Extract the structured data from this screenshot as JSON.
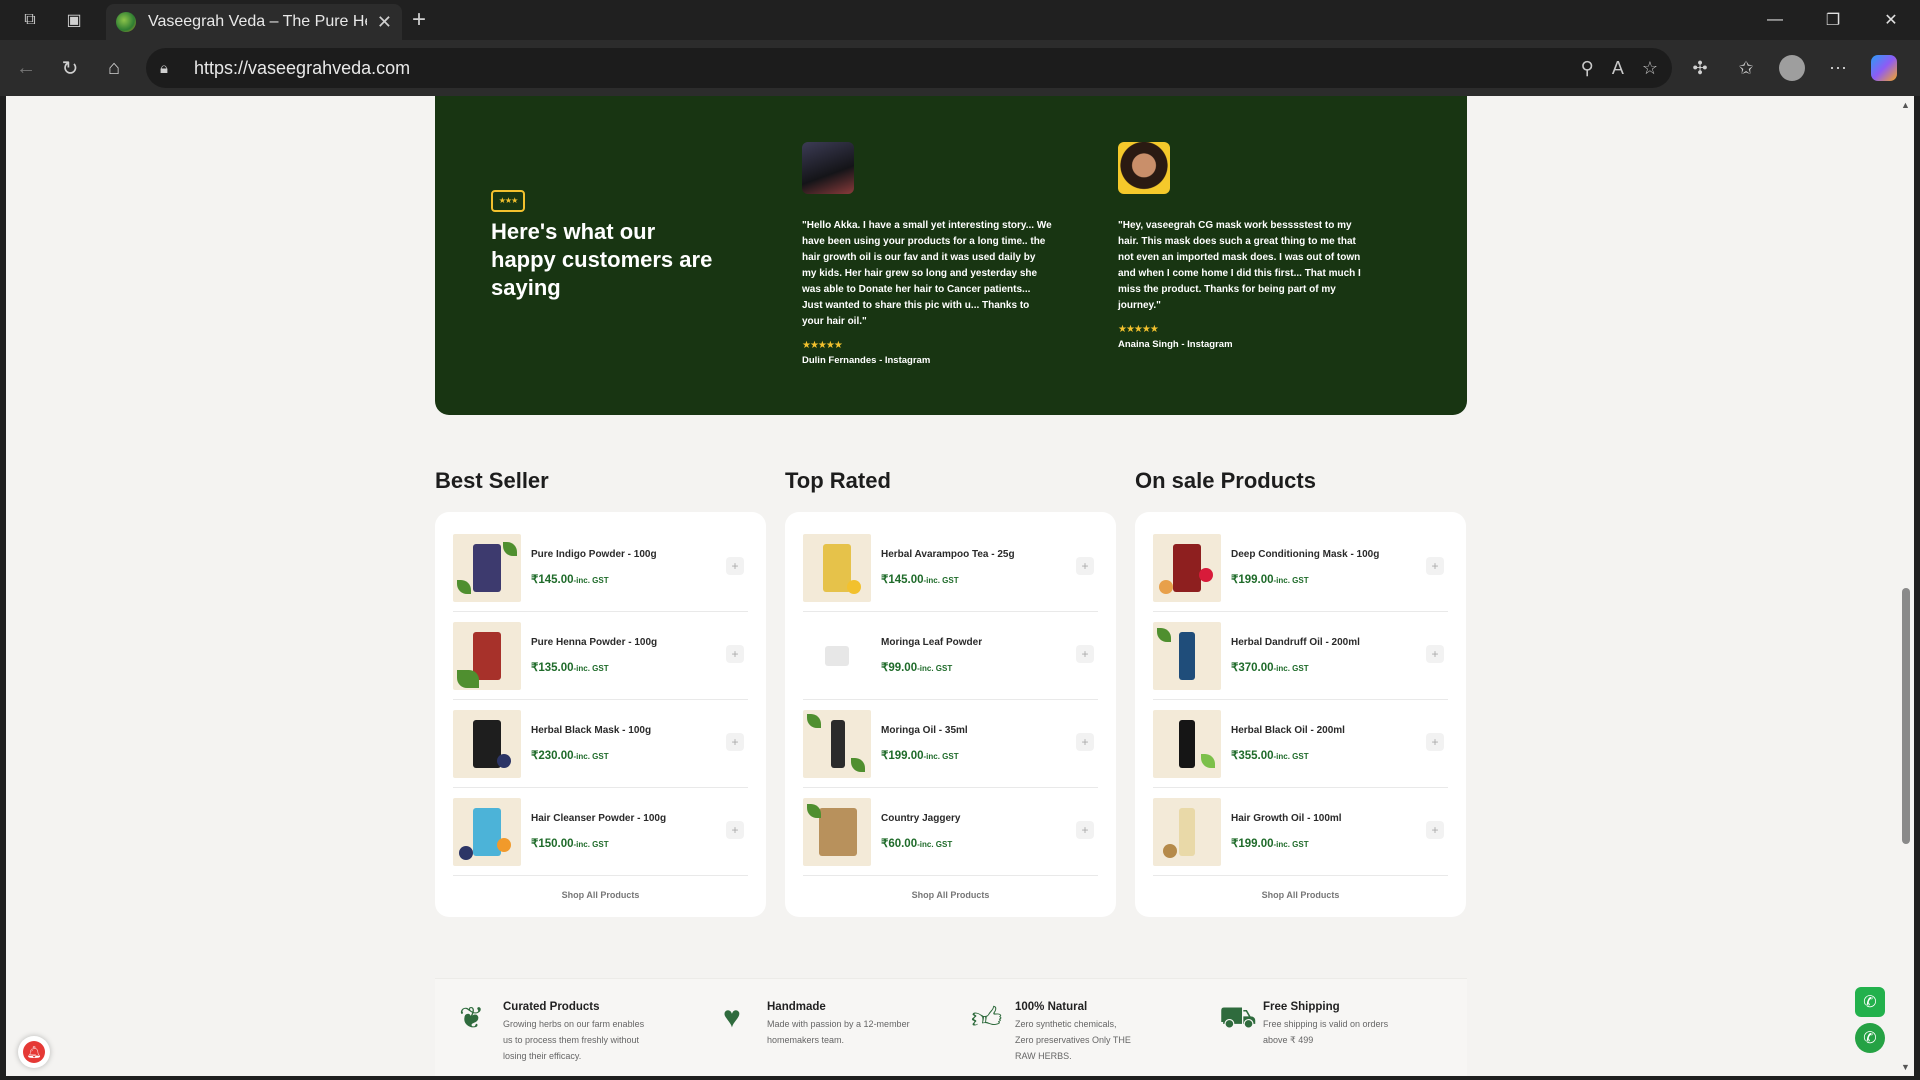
{
  "browser": {
    "tab_title": "Vaseegrah Veda – The Pure Herba",
    "url": "https://vaseegrahveda.com"
  },
  "testimonials": {
    "heading": "Here's what our happy customers are saying",
    "reviews": [
      {
        "text": "\"Hello Akka. I have a small yet interesting story... We have been using your products for a long time.. the hair growth oil is our fav and it was used daily by my kids. Her hair grew so long and yesterday she was able to Donate her hair to Cancer patients... Just wanted to share this pic with u... Thanks to your hair oil.\"",
        "stars": "★★★★★",
        "author": "Dulin Fernandes - Instagram"
      },
      {
        "text": "\"Hey, vaseegrah CG mask work besssstest to my hair. This mask does such a great thing to me that not even an imported mask does. I was out of town and when I come home I did this first... That much I miss the product. Thanks for being part of my journey.\"",
        "stars": "★★★★★",
        "author": "Anaina Singh - Instagram"
      }
    ]
  },
  "columns": [
    {
      "title": "Best Seller",
      "items": [
        {
          "name": "Pure Indigo Powder - 100g",
          "price": "₹145.00",
          "tax": "-inc. GST"
        },
        {
          "name": "Pure Henna Powder - 100g",
          "price": "₹135.00",
          "tax": "-inc. GST"
        },
        {
          "name": "Herbal Black Mask - 100g",
          "price": "₹230.00",
          "tax": "-inc. GST"
        },
        {
          "name": "Hair Cleanser Powder - 100g",
          "price": "₹150.00",
          "tax": "-inc. GST"
        }
      ],
      "shop_all": "Shop All Products"
    },
    {
      "title": "Top Rated",
      "items": [
        {
          "name": "Herbal Avarampoo Tea - 25g",
          "price": "₹145.00",
          "tax": "-inc. GST"
        },
        {
          "name": "Moringa Leaf Powder",
          "price": "₹99.00",
          "tax": "-inc. GST"
        },
        {
          "name": "Moringa Oil - 35ml",
          "price": "₹199.00",
          "tax": "-inc. GST"
        },
        {
          "name": "Country Jaggery",
          "price": "₹60.00",
          "tax": "-inc. GST"
        }
      ],
      "shop_all": "Shop All Products"
    },
    {
      "title": "On sale Products",
      "items": [
        {
          "name": "Deep Conditioning Mask - 100g",
          "price": "₹199.00",
          "tax": "-inc. GST"
        },
        {
          "name": "Herbal Dandruff Oil - 200ml",
          "price": "₹370.00",
          "tax": "-inc. GST"
        },
        {
          "name": "Herbal Black Oil - 200ml",
          "price": "₹355.00",
          "tax": "-inc. GST"
        },
        {
          "name": "Hair Growth Oil - 100ml",
          "price": "₹199.00",
          "tax": "-inc. GST"
        }
      ],
      "shop_all": "Shop All Products"
    }
  ],
  "features": [
    {
      "icon": "sprout-icon",
      "title": "Curated Products",
      "text": "Growing herbs on our farm enables us to process them freshly without losing their efficacy."
    },
    {
      "icon": "hand-heart-icon",
      "title": "Handmade",
      "text": "Made with passion by a 12-member homemakers team."
    },
    {
      "icon": "thumbs-up-icon",
      "title": "100% Natural",
      "text": "Zero synthetic chemicals, Zero preservatives Only THE RAW HERBS."
    },
    {
      "icon": "truck-icon",
      "title": "Free Shipping",
      "text": "Free shipping is valid on orders above ₹ 499"
    }
  ],
  "colors": {
    "brand_green": "#183512",
    "price_green": "#1f6b2a",
    "star_gold": "#f2c12e"
  }
}
